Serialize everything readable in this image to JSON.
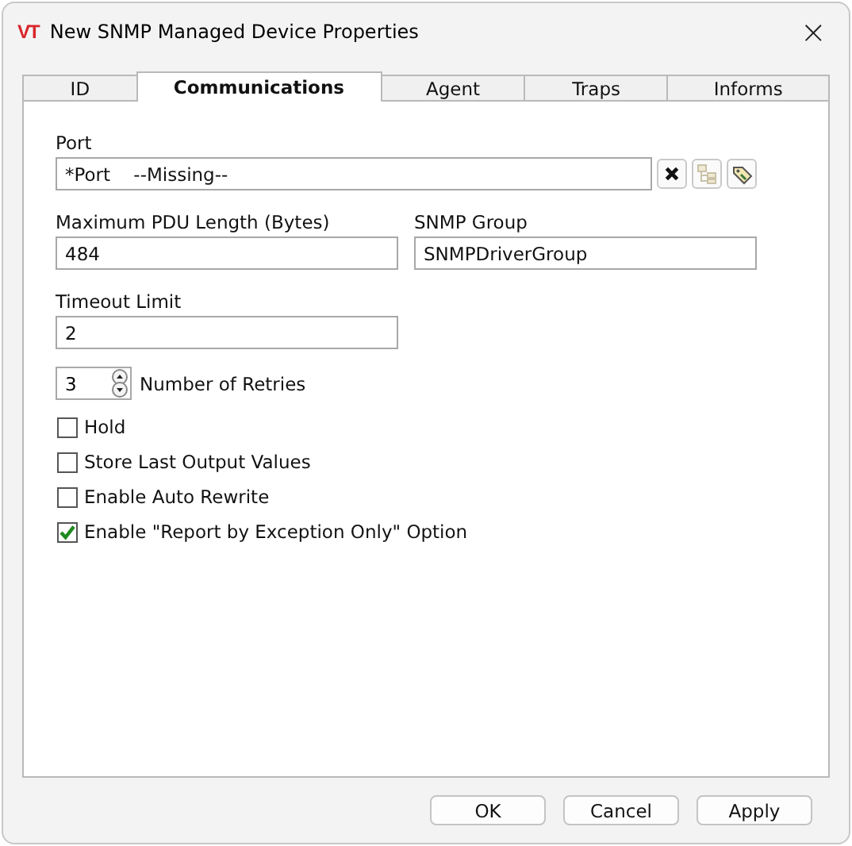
{
  "window": {
    "logo": "VT",
    "title": "New SNMP Managed Device Properties",
    "close": "×"
  },
  "tabs": [
    {
      "label": "ID",
      "selected": false
    },
    {
      "label": "Communications",
      "selected": true
    },
    {
      "label": "Agent",
      "selected": false
    },
    {
      "label": "Traps",
      "selected": false
    },
    {
      "label": "Informs",
      "selected": false
    }
  ],
  "port": {
    "label": "Port",
    "value": "*Port    --Missing--"
  },
  "pdu": {
    "label": "Maximum PDU Length (Bytes)",
    "value": "484"
  },
  "group": {
    "label": "SNMP Group",
    "value": "SNMPDriverGroup"
  },
  "timeout": {
    "label": "Timeout Limit",
    "value": "2"
  },
  "retries": {
    "label": "Number of Retries",
    "value": "3"
  },
  "options": [
    {
      "label": "Hold",
      "checked": false
    },
    {
      "label": "Store Last Output Values",
      "checked": false
    },
    {
      "label": "Enable Auto Rewrite",
      "checked": false
    },
    {
      "label": "Enable \"Report by Exception Only\" Option",
      "checked": true
    }
  ],
  "buttons": [
    "OK",
    "Cancel",
    "Apply"
  ]
}
